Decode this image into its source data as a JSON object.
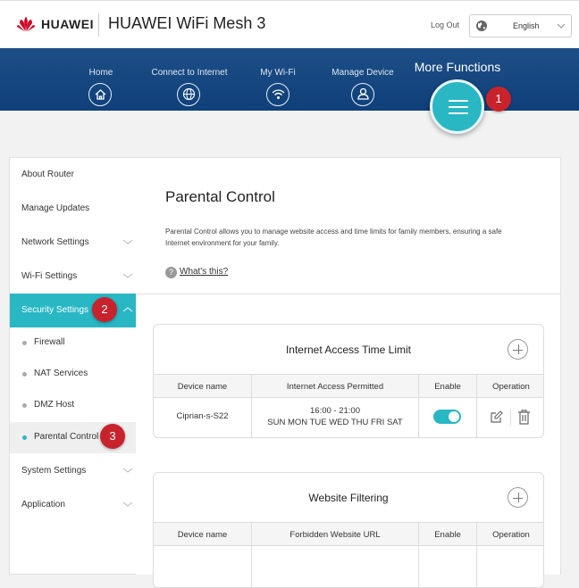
{
  "header": {
    "brand": "HUAWEI",
    "product": "HUAWEI WiFi Mesh 3",
    "logout_label": "Log Out",
    "language": "English"
  },
  "nav": {
    "items": [
      {
        "label": "Home",
        "icon": "home-icon"
      },
      {
        "label": "Connect to Internet",
        "icon": "globe-icon"
      },
      {
        "label": "My Wi-Fi",
        "icon": "wifi-icon"
      },
      {
        "label": "Manage Device",
        "icon": "user-icon"
      }
    ],
    "more_functions": "More Functions"
  },
  "badges": {
    "one": "1",
    "two": "2",
    "three": "3"
  },
  "sidebar": {
    "items": [
      {
        "label": "About Router"
      },
      {
        "label": "Manage Updates"
      },
      {
        "label": "Network Settings"
      },
      {
        "label": "Wi-Fi Settings"
      },
      {
        "label": "Security Settings"
      },
      {
        "label": "Firewall"
      },
      {
        "label": "NAT Services"
      },
      {
        "label": "DMZ Host"
      },
      {
        "label": "Parental Control"
      },
      {
        "label": "System Settings"
      },
      {
        "label": "Application"
      }
    ]
  },
  "main": {
    "title": "Parental Control",
    "description": "Parental Control allows you to manage website access and time limits for family members, ensuring a safe Internet environment for your family.",
    "help_link": "What's this?",
    "help_icon": "?"
  },
  "time_limit": {
    "title": "Internet Access Time Limit",
    "columns": [
      "Device name",
      "Internet Access Permitted",
      "Enable",
      "Operation"
    ],
    "rows": [
      {
        "device": "Ciprian-s-S22",
        "time": "16:00 - 21:00",
        "days": "SUN MON TUE WED THU FRI SAT",
        "enabled": true
      }
    ]
  },
  "website_filtering": {
    "title": "Website Filtering",
    "columns": [
      "Device name",
      "Forbidden Website URL",
      "Enable",
      "Operation"
    ]
  },
  "colors": {
    "accent": "#29b7c4",
    "nav": "#1d4e86",
    "badge": "#c8232c"
  }
}
